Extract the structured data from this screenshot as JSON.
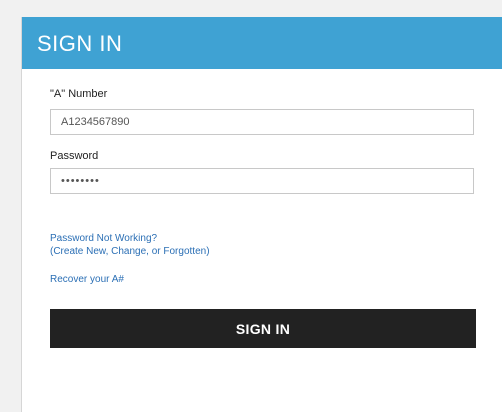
{
  "header": {
    "title": "SIGN IN"
  },
  "form": {
    "a_number_label": "\"A\" Number",
    "a_number_value": "A1234567890",
    "password_label": "Password",
    "password_value": "••••••••",
    "password_help_line1": "Password Not Working?",
    "password_help_line2": "(Create New, Change, or Forgotten)",
    "recover_link": "Recover your A#",
    "submit_label": "SIGN IN"
  },
  "colors": {
    "header_background": "#3fa2d3",
    "button_background": "#222222",
    "link": "#2b6fb5"
  }
}
